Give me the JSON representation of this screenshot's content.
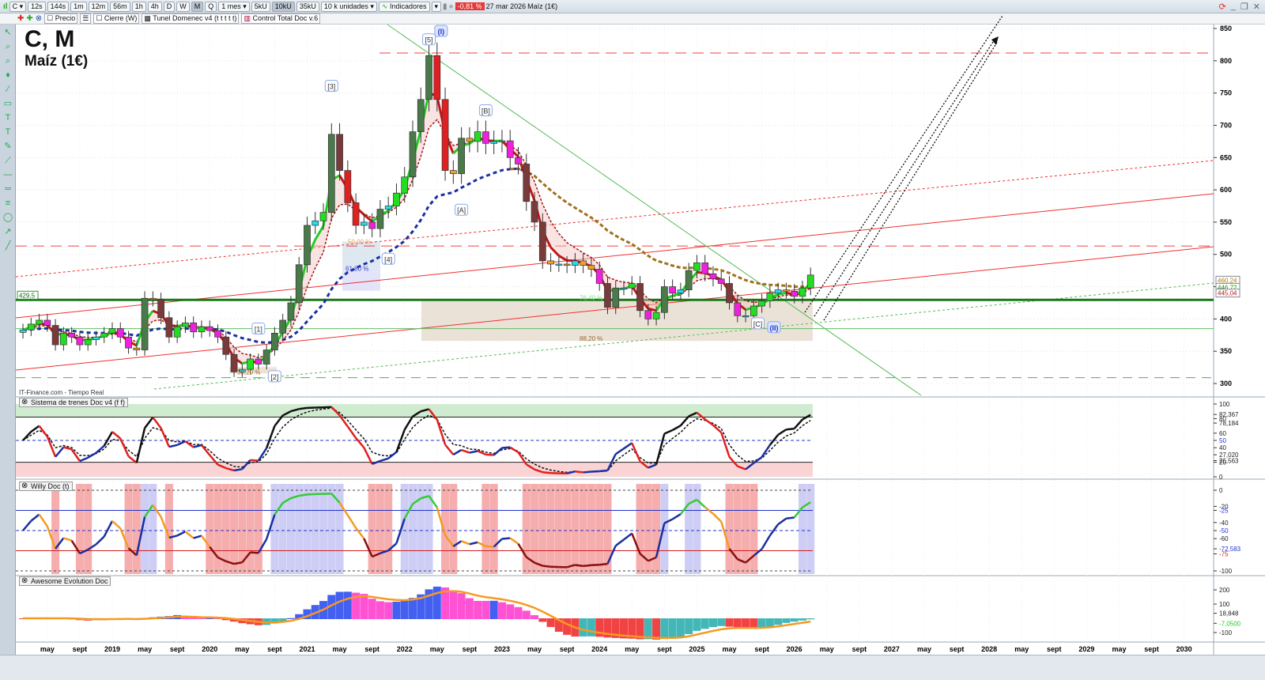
{
  "toolbar": {
    "symbol": "C",
    "intervals": [
      "12s",
      "144s",
      "1m",
      "12m",
      "56m",
      "1h",
      "4h",
      "D",
      "W",
      "M",
      "Q"
    ],
    "active_interval": "M",
    "period": "1 mes",
    "units_buttons": [
      "5kU",
      "10kU",
      "35kU"
    ],
    "active_units": "10kU",
    "units_select": "10 k unidades",
    "indicators_label": "Indicadores",
    "change": "-0,81 %",
    "date": "27 mar 2026",
    "instrument": "Maíz (1€)"
  },
  "legend_bar": {
    "items": [
      "Precio",
      "Cierre (W)",
      "Tunel Domenec v4 (t t t t t)",
      "Control Total Doc v.6"
    ]
  },
  "header": {
    "title": "C, M",
    "subtitle": "Maíz (1€)"
  },
  "source": "IT-Finance.com - Tiempo Real",
  "panels": {
    "p1": "Sistema de trenes Doc v4 (f f)",
    "p2": "Willy Doc (t)",
    "p3": "Awesome Evolution Doc"
  },
  "colors": {
    "up": "#22dd22",
    "down": "#e02020",
    "tunnel_up": "#22cc22",
    "tunnel_down": "#c01818",
    "slow": "#1a2fa0",
    "brown": "#a0701a"
  },
  "chart_data": {
    "type": "candlestick",
    "title": "C, M - Maíz (1€)",
    "start_month": "2018-02",
    "end_month": "2026-03",
    "closes": [
      383,
      392,
      398,
      390,
      360,
      378,
      372,
      360,
      368,
      372,
      378,
      385,
      372,
      355,
      352,
      432,
      430,
      402,
      372,
      388,
      394,
      380,
      388,
      382,
      372,
      345,
      318,
      322,
      338,
      330,
      352,
      378,
      398,
      425,
      484,
      545,
      552,
      565,
      686,
      630,
      580,
      545,
      550,
      540,
      570,
      575,
      595,
      620,
      690,
      740,
      808,
      740,
      630,
      625,
      680,
      675,
      690,
      672,
      675,
      676,
      650,
      640,
      582,
      550,
      490,
      485,
      485,
      483,
      490,
      483,
      477,
      455,
      418,
      448,
      448,
      455,
      413,
      400,
      410,
      450,
      440,
      445,
      475,
      487,
      470,
      462,
      455,
      425,
      405,
      405,
      420,
      428,
      440,
      445,
      443,
      435,
      448,
      468
    ],
    "ylim": [
      290,
      870
    ],
    "yticks": [
      "850",
      "800",
      "750",
      "700",
      "650",
      "600",
      "550",
      "500",
      "450",
      "400",
      "350",
      "300"
    ],
    "xticks": [
      {
        "m": -8,
        "t": "may"
      },
      {
        "m": -4,
        "t": "sept"
      },
      {
        "m": 0,
        "t": "2019"
      },
      {
        "m": 4,
        "t": "may"
      },
      {
        "m": 8,
        "t": "sept"
      },
      {
        "m": 12,
        "t": "2020"
      },
      {
        "m": 16,
        "t": "may"
      },
      {
        "m": 20,
        "t": "sept"
      },
      {
        "m": 24,
        "t": "2021"
      },
      {
        "m": 28,
        "t": "may"
      },
      {
        "m": 32,
        "t": "sept"
      },
      {
        "m": 36,
        "t": "2022"
      },
      {
        "m": 40,
        "t": "may"
      },
      {
        "m": 44,
        "t": "sept"
      },
      {
        "m": 48,
        "t": "2023"
      },
      {
        "m": 52,
        "t": "may"
      },
      {
        "m": 56,
        "t": "sept"
      },
      {
        "m": 60,
        "t": "2024"
      },
      {
        "m": 64,
        "t": "may"
      },
      {
        "m": 68,
        "t": "sept"
      },
      {
        "m": 72,
        "t": "2025"
      },
      {
        "m": 76,
        "t": "may"
      },
      {
        "m": 80,
        "t": "sept"
      },
      {
        "m": 84,
        "t": "2026"
      },
      {
        "m": 88,
        "t": "may"
      },
      {
        "m": 92,
        "t": "sept"
      },
      {
        "m": 96,
        "t": "2027"
      },
      {
        "m": 100,
        "t": "may"
      },
      {
        "m": 104,
        "t": "sept"
      },
      {
        "m": 108,
        "t": "2028"
      },
      {
        "m": 112,
        "t": "may"
      },
      {
        "m": 116,
        "t": "sept"
      },
      {
        "m": 120,
        "t": "2029"
      },
      {
        "m": 124,
        "t": "may"
      },
      {
        "m": 128,
        "t": "sept"
      },
      {
        "m": 132,
        "t": "2030"
      }
    ],
    "levels": [
      {
        "price": 812,
        "style": "red-dashed"
      },
      {
        "price": 513,
        "style": "red-dashed"
      },
      {
        "price": 429.5,
        "style": "green-solid",
        "label": "429,5"
      },
      {
        "price": 385,
        "style": "green-thin"
      },
      {
        "price": 309,
        "style": "green-dashed"
      }
    ],
    "fib_labels": [
      {
        "text": "50,00 %",
        "price": 520
      },
      {
        "text": "61,80 %",
        "price": 478
      },
      {
        "text": "76,40 %",
        "price": 433
      },
      {
        "text": "88,20 %",
        "price": 370
      },
      {
        "text": "38,20 %",
        "price": 318
      }
    ],
    "waves": [
      {
        "t": "[5]",
        "m": 39,
        "p": 832
      },
      {
        "t": "(I)",
        "m": 40.5,
        "p": 845
      },
      {
        "t": "[3]",
        "m": 27,
        "p": 760
      },
      {
        "t": "[B]",
        "m": 46,
        "p": 722
      },
      {
        "t": "[A]",
        "m": 43,
        "p": 568
      },
      {
        "t": "[4]",
        "m": 34,
        "p": 492
      },
      {
        "t": "[1]",
        "m": 18,
        "p": 384
      },
      {
        "t": "[2]",
        "m": 20,
        "p": 310
      },
      {
        "t": "[C]",
        "m": 79.5,
        "p": 392
      },
      {
        "t": "(II)",
        "m": 81.5,
        "p": 386
      }
    ],
    "price_tags": [
      "460,24",
      "446,72",
      "445,04"
    ],
    "p1_ticks": [
      "100",
      "82,367",
      "80",
      "78,184",
      "60",
      "50",
      "40",
      "27,020",
      "26,563",
      "20",
      "0"
    ],
    "p2_ticks": [
      "0",
      "-20",
      "-25",
      "-40",
      "-50",
      "-60",
      "-72,583",
      "-75",
      "-100"
    ],
    "p3_ticks": [
      "200",
      "100",
      "18,848",
      "-7,0500",
      "-100"
    ]
  }
}
